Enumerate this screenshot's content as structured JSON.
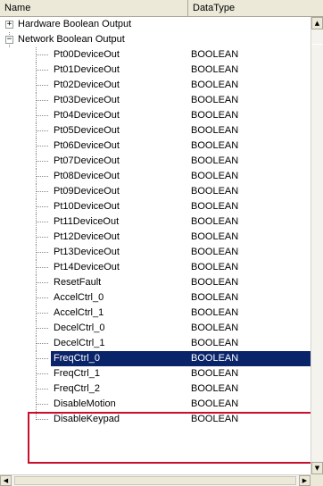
{
  "columns": {
    "name": "Name",
    "type": "DataType"
  },
  "tree": {
    "roots": [
      {
        "label": "Hardware Boolean Output",
        "expander": "+"
      },
      {
        "label": "Network Boolean Output",
        "expander": "−"
      }
    ],
    "children": [
      {
        "name": "Pt00DeviceOut",
        "type": "BOOLEAN"
      },
      {
        "name": "Pt01DeviceOut",
        "type": "BOOLEAN"
      },
      {
        "name": "Pt02DeviceOut",
        "type": "BOOLEAN"
      },
      {
        "name": "Pt03DeviceOut",
        "type": "BOOLEAN"
      },
      {
        "name": "Pt04DeviceOut",
        "type": "BOOLEAN"
      },
      {
        "name": "Pt05DeviceOut",
        "type": "BOOLEAN"
      },
      {
        "name": "Pt06DeviceOut",
        "type": "BOOLEAN"
      },
      {
        "name": "Pt07DeviceOut",
        "type": "BOOLEAN"
      },
      {
        "name": "Pt08DeviceOut",
        "type": "BOOLEAN"
      },
      {
        "name": "Pt09DeviceOut",
        "type": "BOOLEAN"
      },
      {
        "name": "Pt10DeviceOut",
        "type": "BOOLEAN"
      },
      {
        "name": "Pt11DeviceOut",
        "type": "BOOLEAN"
      },
      {
        "name": "Pt12DeviceOut",
        "type": "BOOLEAN"
      },
      {
        "name": "Pt13DeviceOut",
        "type": "BOOLEAN"
      },
      {
        "name": "Pt14DeviceOut",
        "type": "BOOLEAN"
      },
      {
        "name": "ResetFault",
        "type": "BOOLEAN"
      },
      {
        "name": "AccelCtrl_0",
        "type": "BOOLEAN"
      },
      {
        "name": "AccelCtrl_1",
        "type": "BOOLEAN"
      },
      {
        "name": "DecelCtrl_0",
        "type": "BOOLEAN"
      },
      {
        "name": "DecelCtrl_1",
        "type": "BOOLEAN"
      },
      {
        "name": "FreqCtrl_0",
        "type": "BOOLEAN",
        "selected": true
      },
      {
        "name": "FreqCtrl_1",
        "type": "BOOLEAN"
      },
      {
        "name": "FreqCtrl_2",
        "type": "BOOLEAN"
      },
      {
        "name": "DisableMotion",
        "type": "BOOLEAN"
      },
      {
        "name": "DisableKeypad",
        "type": "BOOLEAN"
      }
    ]
  },
  "highlight_color": "#c8102e",
  "selection_color": "#0a246a",
  "scrollbars": {
    "up": "▲",
    "down": "▼",
    "left": "◀",
    "right": "▶"
  }
}
